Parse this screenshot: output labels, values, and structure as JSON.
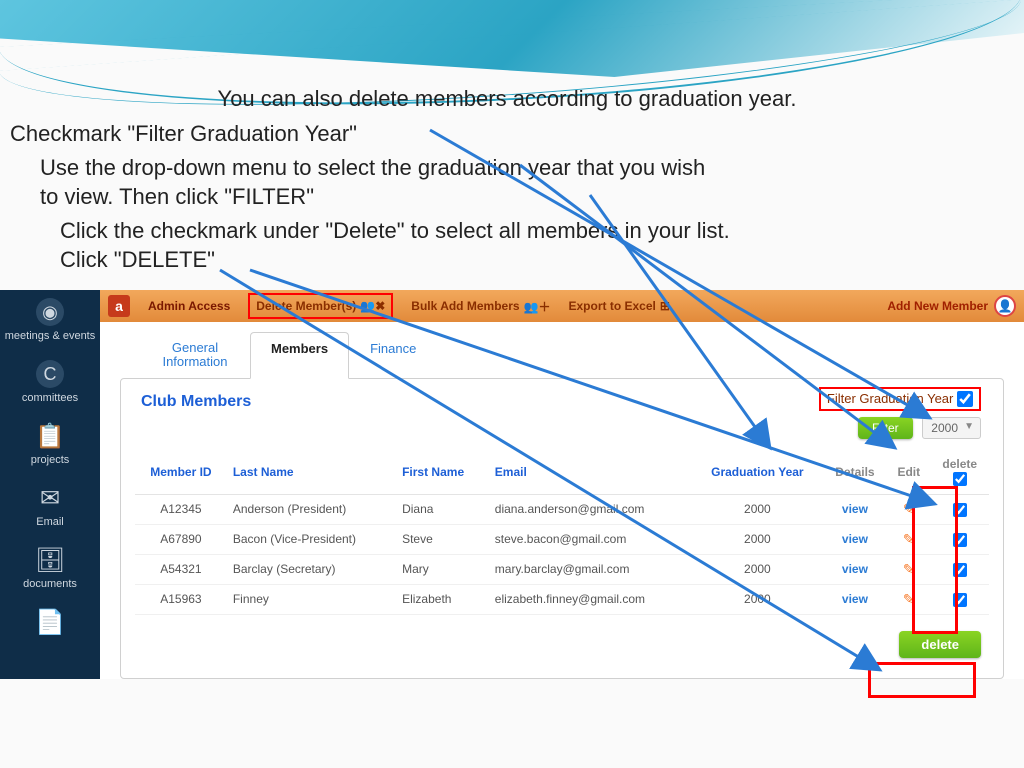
{
  "instructions": {
    "title": "You can also delete members according to graduation year.",
    "line2": "Checkmark \"Filter Graduation Year\"",
    "line3": "Use the drop-down menu to select the graduation year that you wish to view.  Then click \"FILTER\"",
    "line4": "Click the checkmark under \"Delete\" to select all members in your list. Click \"DELETE\""
  },
  "sidebar": [
    {
      "label": "meetings & events",
      "icon": "C"
    },
    {
      "label": "committees",
      "icon": "C"
    },
    {
      "label": "projects",
      "icon": "📋"
    },
    {
      "label": "Email",
      "icon": "✉"
    },
    {
      "label": "documents",
      "icon": "🗄"
    },
    {
      "label": "",
      "icon": "📄"
    }
  ],
  "toolbar": {
    "badge": "a",
    "admin": "Admin Access",
    "delete": "Delete Member(s)",
    "bulkadd": "Bulk Add Members",
    "export": "Export to Excel",
    "addnew": "Add New Member"
  },
  "tabs": [
    "General Information",
    "Members",
    "Finance"
  ],
  "panel_title": "Club Members",
  "filter": {
    "label": "Filter Graduation Year",
    "button": "Filter",
    "year": "2000"
  },
  "columns": [
    "Member ID",
    "Last Name",
    "First Name",
    "Email",
    "Graduation Year",
    "Details",
    "Edit",
    "delete"
  ],
  "rows": [
    {
      "id": "A12345",
      "ln": "Anderson (President)",
      "fn": "Diana",
      "em": "diana.anderson@gmail.com",
      "yr": "2000"
    },
    {
      "id": "A67890",
      "ln": "Bacon (Vice-President)",
      "fn": "Steve",
      "em": "steve.bacon@gmail.com",
      "yr": "2000"
    },
    {
      "id": "A54321",
      "ln": "Barclay (Secretary)",
      "fn": "Mary",
      "em": "mary.barclay@gmail.com",
      "yr": "2000"
    },
    {
      "id": "A15963",
      "ln": "Finney",
      "fn": "Elizabeth",
      "em": "elizabeth.finney@gmail.com",
      "yr": "2000"
    }
  ],
  "view_label": "view",
  "delete_button": "delete"
}
